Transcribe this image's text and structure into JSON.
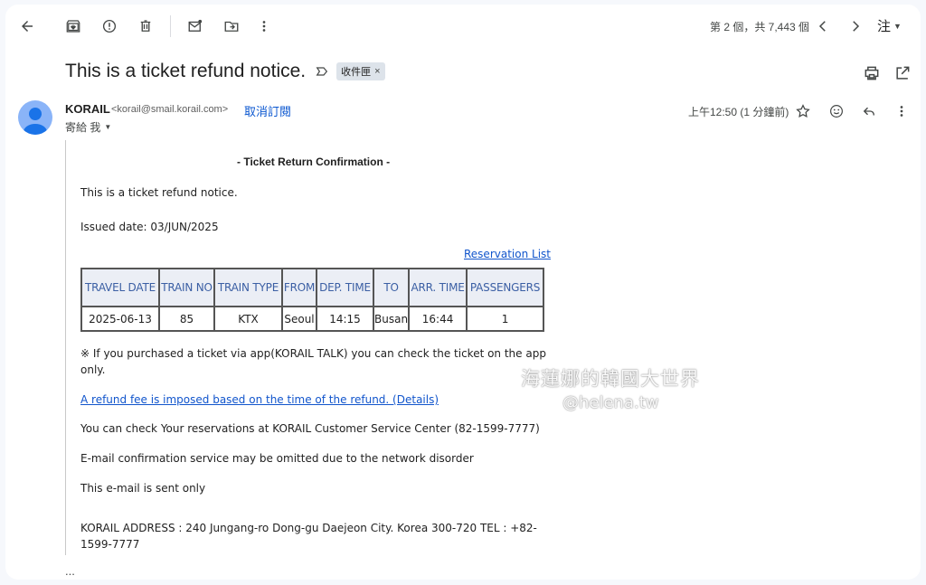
{
  "toolbar": {
    "pager_text": "第 2 個，共 7,443 個",
    "language": "注"
  },
  "subject": {
    "title": "This is a ticket refund notice.",
    "label_chip": "收件匣",
    "chip_close": "×"
  },
  "sender": {
    "name": "KORAIL",
    "email": "<korail@smail.korail.com>",
    "unsubscribe": "取消訂閱",
    "to": "寄給 我",
    "timestamp": "上午12:50 (1 分鐘前)"
  },
  "mail": {
    "heading": "- Ticket Return Confirmation -",
    "intro": "This is a ticket refund notice.",
    "issued": "Issued date: 03/JUN/2025",
    "reservation_link": "Reservation List",
    "table": {
      "headers": [
        "TRAVEL DATE",
        "TRAIN NO",
        "TRAIN TYPE",
        "FROM",
        "DEP. TIME",
        "TO",
        "ARR. TIME",
        "PASSENGERS"
      ],
      "row": [
        "2025-06-13",
        "85",
        "KTX",
        "Seoul",
        "14:15",
        "Busan",
        "16:44",
        "1"
      ]
    },
    "app_note_1": "※ If you purchased a ticket via app(KORAIL TALK) you can check the ticket on the app",
    "app_note_2": "only.",
    "refund_link": "A refund fee is imposed based on the time of the refund. (Details)",
    "check_line": "You can check Your reservations at KORAIL Customer Service Center (82-1599-7777)",
    "omit_line": "E-mail confirmation service may be omitted due to the network disorder",
    "send_only": "This e-mail is sent only",
    "address_1": "KORAIL ADDRESS : 240 Jungang-ro Dong-gu Daejeon City. Korea 300-720 TEL : +82-",
    "address_2": "1599-7777"
  },
  "trailing": "...",
  "watermark": {
    "line1": "海蓮娜的韓國大世界",
    "line2": "@helena.tw"
  },
  "colors": {
    "link": "#1155cc",
    "accent_blue": "#0b57d0",
    "table_header_bg": "#ebeef5",
    "table_header_text": "#3b5fa4",
    "avatar": "#8ab4f8"
  }
}
